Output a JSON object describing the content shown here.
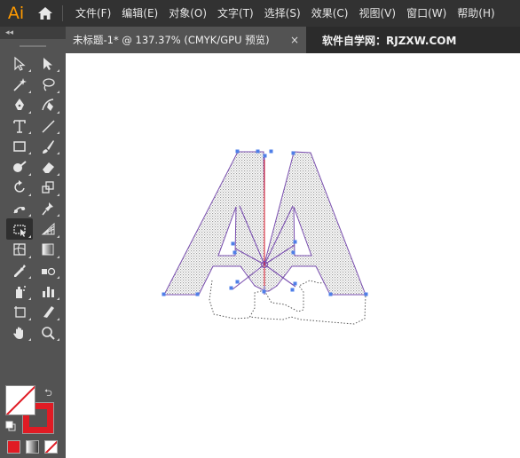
{
  "app": {
    "logo": "Ai"
  },
  "menu": {
    "items": [
      "文件(F)",
      "编辑(E)",
      "对象(O)",
      "文字(T)",
      "选择(S)",
      "效果(C)",
      "视图(V)",
      "窗口(W)",
      "帮助(H)"
    ]
  },
  "tabs": {
    "active_title": "未标题-1* @ 137.37% (CMYK/GPU 预览)",
    "close_glyph": "×",
    "site_label": "软件自学网：RJZXW.COM"
  },
  "toolbar": {
    "collapse_glyph": "◂◂",
    "tools": [
      "selection-tool",
      "direct-selection-tool",
      "magic-wand-tool",
      "lasso-tool",
      "pen-tool",
      "curvature-tool",
      "type-tool",
      "line-segment-tool",
      "rectangle-tool",
      "paintbrush-tool",
      "shaper-tool",
      "eraser-tool",
      "rotate-tool",
      "scale-tool",
      "puppet-warp-tool",
      "pin-tool",
      "free-transform-tool",
      "perspective-grid-tool",
      "mesh-tool",
      "gradient-tool",
      "eyedropper-tool",
      "blend-tool",
      "symbol-sprayer-tool",
      "column-graph-tool",
      "artboard-tool",
      "slice-tool",
      "hand-tool",
      "zoom-tool"
    ],
    "selected_tool": "free-transform-tool"
  },
  "colors": {
    "fill": "none",
    "stroke": "#e01b24",
    "path_outline": "#7a4fb0",
    "anchor": "#4f7fe8",
    "pattern": "#9a9a9a"
  }
}
